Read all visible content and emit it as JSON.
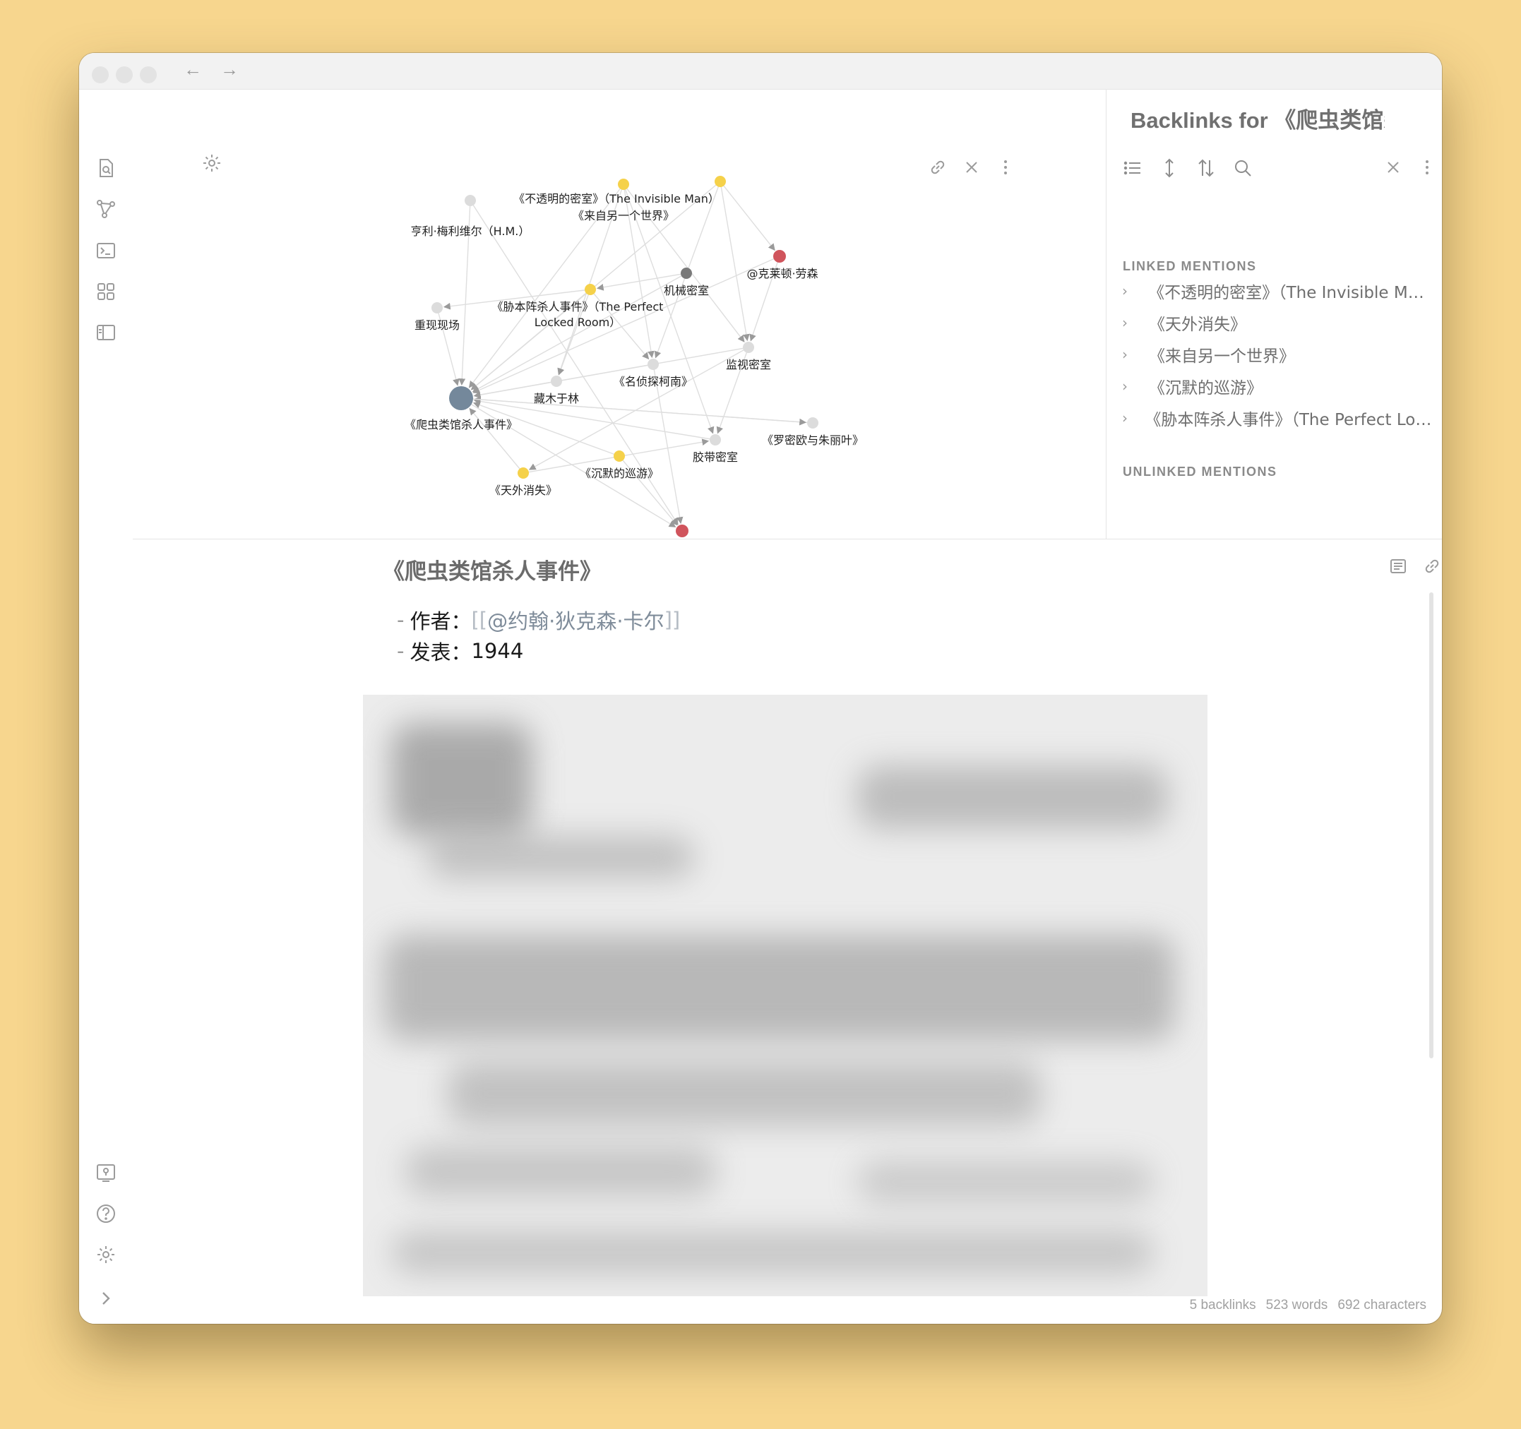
{
  "window": {
    "nav": {
      "back": "←",
      "forward": "→"
    }
  },
  "graph": {
    "nodes": [
      {
        "id": "invisible",
        "label": "《不透明的密室》（The Invisible Man）",
        "color": "#f5d14a"
      },
      {
        "id": "otherworld",
        "label": "《来自另一个世界》",
        "color": "#f5d14a"
      },
      {
        "id": "hm",
        "label": "亨利·梅利维尔（H.M.）",
        "color": "#dcdcdc"
      },
      {
        "id": "clayton",
        "label": "@克莱顿·劳森",
        "color": "#d0545c"
      },
      {
        "id": "mech",
        "label": "机械密室",
        "color": "#7a7a7a"
      },
      {
        "id": "perfect",
        "label": "《胁本阵杀人事件》（The Perfect Locked Room）",
        "color": "#f5d14a"
      },
      {
        "id": "scene",
        "label": "重现现场",
        "color": "#dcdcdc"
      },
      {
        "id": "monitor",
        "label": "监视密室",
        "color": "#dcdcdc"
      },
      {
        "id": "conan",
        "label": "《名侦探柯南》",
        "color": "#dcdcdc"
      },
      {
        "id": "tree",
        "label": "藏木于林",
        "color": "#dcdcdc"
      },
      {
        "id": "reptile",
        "label": "《爬虫类馆杀人事件》",
        "color": "#74889b"
      },
      {
        "id": "romeo",
        "label": "《罗密欧与朱丽叶》",
        "color": "#dcdcdc"
      },
      {
        "id": "tape",
        "label": "胶带密室",
        "color": "#dcdcdc"
      },
      {
        "id": "silent",
        "label": "《沉默的巡游》",
        "color": "#f5d14a"
      },
      {
        "id": "vanish",
        "label": "《天外消失》",
        "color": "#f5d14a"
      },
      {
        "id": "carr",
        "label": "@约翰·狄克森·卡尔",
        "color": "#d0545c"
      }
    ]
  },
  "backlinks": {
    "title": "Backlinks for 《爬虫类馆杀人事件》",
    "linked_heading": "LINKED MENTIONS",
    "unlinked_heading": "UNLINKED MENTIONS",
    "linked": [
      "《不透明的密室》（The Invisible Man）",
      "《天外消失》",
      "《来自另一个世界》",
      "《沉默的巡游》",
      "《胁本阵杀人事件》（The Perfect Locked Room）"
    ]
  },
  "editor": {
    "title": "《爬虫类馆杀人事件》",
    "meta": [
      {
        "dash": "-",
        "key": "作者：",
        "link_open": "[[",
        "link": "@约翰·狄克森·卡尔",
        "link_close": "]]"
      },
      {
        "dash": "-",
        "key": "发表：",
        "value": "1944"
      }
    ]
  },
  "status": {
    "backlinks": "5 backlinks",
    "words": "523 words",
    "characters": "692 characters"
  }
}
